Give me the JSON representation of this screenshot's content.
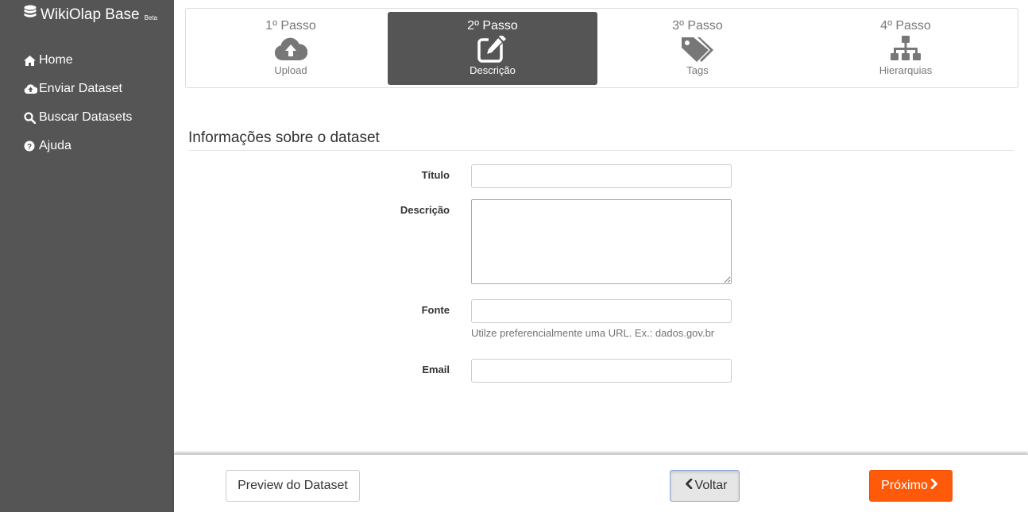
{
  "sidebar": {
    "brand": {
      "name": "WikiOlap Base",
      "badge": "Beta",
      "icon": "database-icon"
    },
    "items": [
      {
        "label": "Home",
        "icon": "home-icon"
      },
      {
        "label": "Enviar Dataset",
        "icon": "cloud-upload-icon"
      },
      {
        "label": "Buscar Datasets",
        "icon": "search-icon"
      },
      {
        "label": "Ajuda",
        "icon": "question-circle-icon"
      }
    ]
  },
  "steps": [
    {
      "number": "1º Passo",
      "label": "Upload",
      "icon": "cloud-upload-icon",
      "active": false
    },
    {
      "number": "2º Passo",
      "label": "Descrição",
      "icon": "edit-icon",
      "active": true
    },
    {
      "number": "3º Passo",
      "label": "Tags",
      "icon": "tags-icon",
      "active": false
    },
    {
      "number": "4º Passo",
      "label": "Hierarquias",
      "icon": "sitemap-icon",
      "active": false
    }
  ],
  "form": {
    "title": "Informações sobre o dataset",
    "fields": {
      "titulo": {
        "label": "Título",
        "value": ""
      },
      "descricao": {
        "label": "Descrição",
        "value": ""
      },
      "fonte": {
        "label": "Fonte",
        "value": "",
        "help": "Utilze preferencialmente uma URL. Ex.: dados.gov.br"
      },
      "email": {
        "label": "Email",
        "value": ""
      }
    }
  },
  "footer": {
    "preview_label": "Preview do Dataset",
    "back_label": "Voltar",
    "next_label": "Próximo"
  },
  "colors": {
    "sidebar_bg": "#555555",
    "active_step_bg": "#555555",
    "next_button": "#ff5a0a"
  }
}
